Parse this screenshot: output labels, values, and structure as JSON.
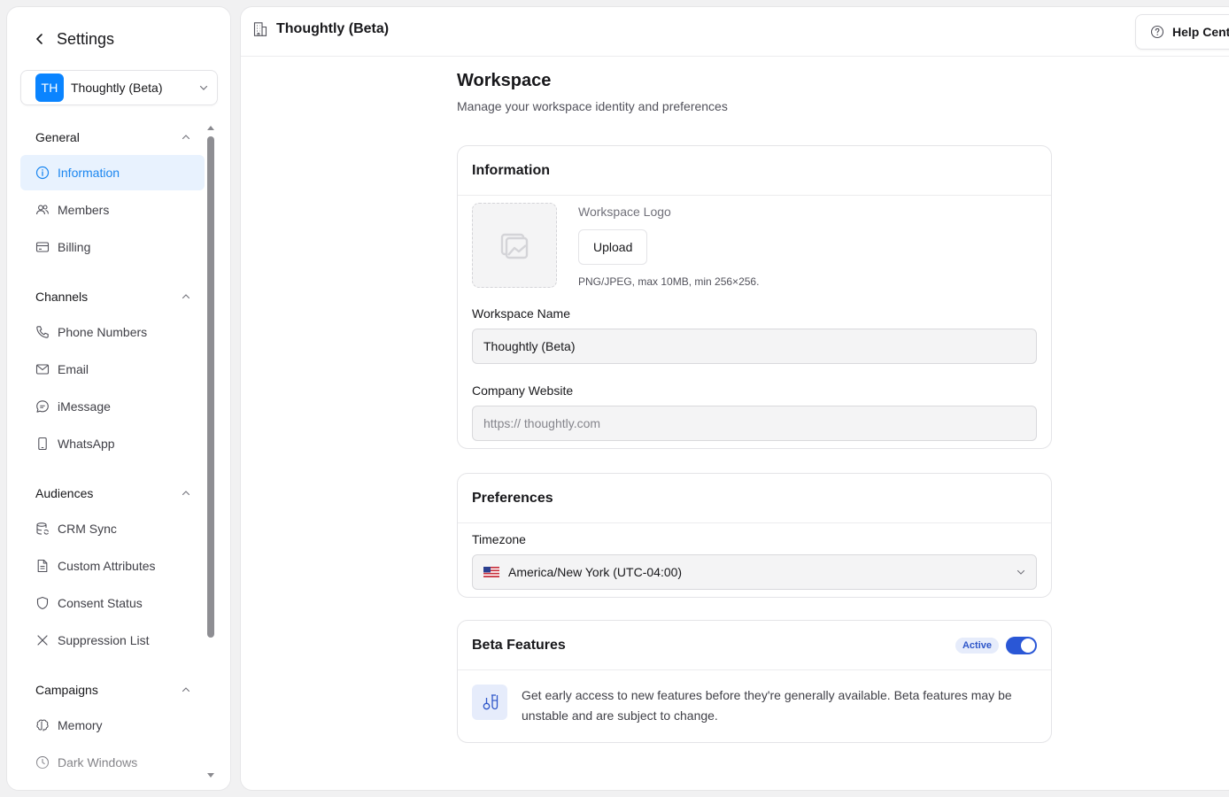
{
  "sidebar": {
    "title": "Settings",
    "workspace": {
      "initials": "TH",
      "name": "Thoughtly (Beta)"
    },
    "groups": [
      {
        "label": "General",
        "items": [
          {
            "label": "Information",
            "icon": "info-icon",
            "active": true
          },
          {
            "label": "Members",
            "icon": "users-icon"
          },
          {
            "label": "Billing",
            "icon": "credit-card-icon"
          }
        ]
      },
      {
        "label": "Channels",
        "items": [
          {
            "label": "Phone Numbers",
            "icon": "phone-icon"
          },
          {
            "label": "Email",
            "icon": "mail-icon"
          },
          {
            "label": "iMessage",
            "icon": "message-icon"
          },
          {
            "label": "WhatsApp",
            "icon": "smartphone-icon"
          }
        ]
      },
      {
        "label": "Audiences",
        "items": [
          {
            "label": "CRM Sync",
            "icon": "database-sync-icon"
          },
          {
            "label": "Custom Attributes",
            "icon": "file-text-icon"
          },
          {
            "label": "Consent Status",
            "icon": "shield-icon"
          },
          {
            "label": "Suppression List",
            "icon": "x-icon"
          }
        ]
      },
      {
        "label": "Campaigns",
        "items": [
          {
            "label": "Memory",
            "icon": "brain-icon"
          },
          {
            "label": "Dark Windows",
            "icon": "clock-icon"
          }
        ]
      }
    ]
  },
  "topbar": {
    "title": "Thoughtly (Beta)",
    "help_label": "Help Cent"
  },
  "page": {
    "title": "Workspace",
    "subtitle": "Manage your workspace identity and preferences"
  },
  "information": {
    "heading": "Information",
    "logo_label": "Workspace Logo",
    "upload_label": "Upload",
    "logo_hint": "PNG/JPEG, max 10MB, min 256×256.",
    "name_label": "Workspace Name",
    "name_value": "Thoughtly (Beta)",
    "website_label": "Company Website",
    "website_placeholder": "https:// thoughtly.com"
  },
  "preferences": {
    "heading": "Preferences",
    "timezone_label": "Timezone",
    "timezone_value": "America/New York (UTC-04:00)"
  },
  "beta": {
    "heading": "Beta Features",
    "badge": "Active",
    "enabled": true,
    "description": "Get early access to new features before they're generally available. Beta features may be unstable and are subject to change."
  },
  "colors": {
    "accent": "#1a86f0",
    "toggle": "#2a57d6",
    "avatar": "#0a84ff"
  }
}
